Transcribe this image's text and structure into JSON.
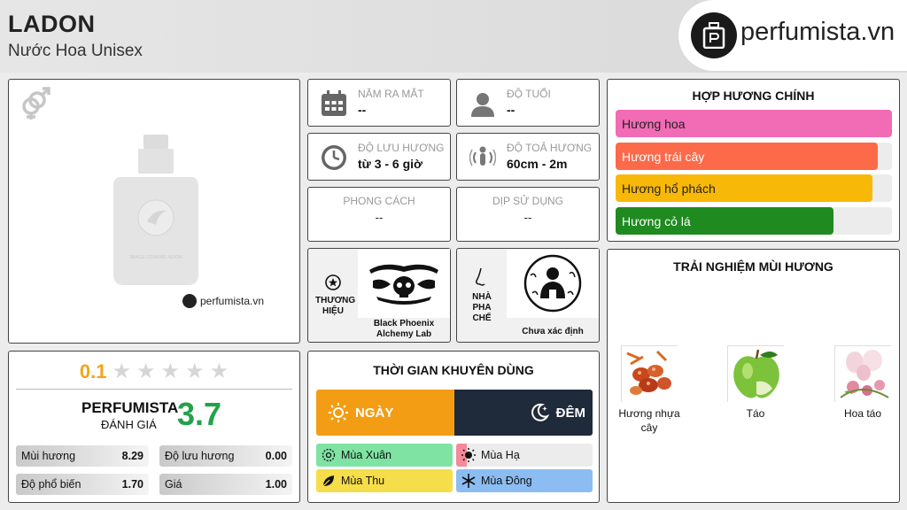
{
  "header": {
    "title": "LADON",
    "subtitle": "Nước Hoa Unisex",
    "logo_text": "perfumista.vn",
    "mini_logo_text": "perfumista.vn",
    "image_placeholder": "IMAGE COMING SOON"
  },
  "rating": {
    "user_score": "0.1",
    "stars_max": 5,
    "perfumista_label": "PERFUMISTA",
    "perfumista_sub": "ĐÁNH GIÁ",
    "perfumista_score": "3.7",
    "metrics": [
      {
        "label": "Mùi hương",
        "value": "8.29"
      },
      {
        "label": "Độ lưu hương",
        "value": "0.00"
      },
      {
        "label": "Độ phổ biến",
        "value": "1.70"
      },
      {
        "label": "Giá",
        "value": "1.00"
      }
    ]
  },
  "info": {
    "release": {
      "label": "NĂM RA MẮT",
      "value": "--"
    },
    "age": {
      "label": "ĐỘ TUỔI",
      "value": "--"
    },
    "longevity": {
      "label": "ĐỘ LƯU HƯƠNG",
      "value": "từ 3 - 6 giờ"
    },
    "sillage": {
      "label": "ĐỘ TOẢ HƯƠNG",
      "value": "60cm - 2m"
    },
    "style": {
      "label": "PHONG CÁCH",
      "value": "--"
    },
    "occasion": {
      "label": "DỊP SỬ DỤNG",
      "value": "--"
    },
    "brand": {
      "label": "THƯƠNG HIỆU",
      "name": "Black Phoenix Alchemy Lab"
    },
    "perfumer": {
      "label": "NHÀ PHA CHẾ",
      "name": "Chưa xác định"
    }
  },
  "accords": {
    "title": "HỢP HƯƠNG CHÍNH",
    "items": [
      {
        "name": "Hương hoa",
        "strength": 1.0,
        "color": "#f26bb5",
        "text_color": "#222"
      },
      {
        "name": "Hương trái cây",
        "strength": 0.95,
        "color": "#fc6a4a",
        "text_color": "#fff"
      },
      {
        "name": "Hương hổ phách",
        "strength": 0.93,
        "color": "#f8b808",
        "text_color": "#222"
      },
      {
        "name": "Hương cỏ lá",
        "strength": 0.79,
        "color": "#1f8a1f",
        "text_color": "#fff"
      }
    ]
  },
  "notes": {
    "title": "TRẢI NGHIỆM MÙI HƯƠNG",
    "items": [
      {
        "name": "Hương nhựa cây",
        "icon": "resin-image"
      },
      {
        "name": "Táo",
        "icon": "apple-image"
      },
      {
        "name": "Hoa táo",
        "icon": "apple-blossom-image"
      }
    ]
  },
  "time": {
    "title": "THỜI GIAN KHUYÊN DÙNG",
    "day_label": "NGÀY",
    "night_label": "ĐÊM",
    "day_level": 1.0,
    "night_level": 0.0,
    "seasons": [
      {
        "name": "Mùa Xuân",
        "level": 1.0,
        "color": "#7ee3a3",
        "icon": "spring-icon"
      },
      {
        "name": "Mùa Hạ",
        "level": 0.08,
        "color": "#f48a9a",
        "icon": "summer-icon"
      },
      {
        "name": "Mùa Thu",
        "level": 1.0,
        "color": "#f6dd4a",
        "icon": "autumn-icon"
      },
      {
        "name": "Mùa Đông",
        "level": 1.0,
        "color": "#8cbdf2",
        "icon": "winter-icon"
      }
    ]
  }
}
